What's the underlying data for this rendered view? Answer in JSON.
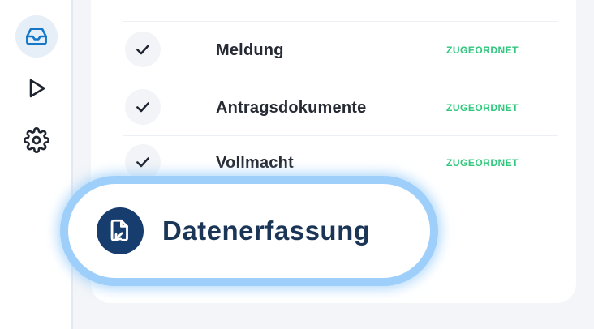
{
  "sidebar": {
    "items": [
      {
        "icon": "inbox-icon",
        "active": true
      },
      {
        "icon": "play-icon",
        "active": false
      },
      {
        "icon": "gear-icon",
        "active": false
      }
    ]
  },
  "documents": [
    {
      "title": "Meldung",
      "status": "ZUGEORDNET"
    },
    {
      "title": "Antragsdokumente",
      "status": "ZUGEORDNET"
    },
    {
      "title": "Vollmacht",
      "status": "ZUGEORDNET"
    }
  ],
  "highlight": {
    "label": "Datenerfassung",
    "icon": "document-transfer-icon"
  },
  "colors": {
    "status_green": "#2fc77c",
    "accent_blue": "#1577c8",
    "highlight_ring": "#9dcffa",
    "dark_navy": "#163d6e"
  }
}
